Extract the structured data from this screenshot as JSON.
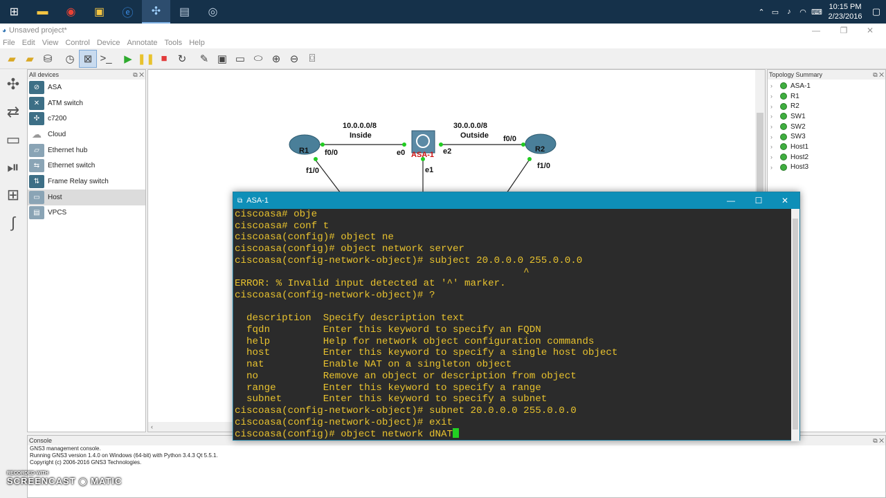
{
  "taskbar": {
    "icons": [
      "windows-icon",
      "file-explorer-icon",
      "chrome-icon",
      "app-icon",
      "edge-icon",
      "gns3-icon",
      "notepad-icon",
      "media-icon"
    ],
    "clock_time": "10:15 PM",
    "clock_date": "2/23/2016"
  },
  "window": {
    "title": "Unsaved project*"
  },
  "menu": [
    "File",
    "Edit",
    "View",
    "Control",
    "Device",
    "Annotate",
    "Tools",
    "Help"
  ],
  "devices_panel": {
    "title": "All devices",
    "items": [
      {
        "label": "ASA",
        "icon": "asa-icon"
      },
      {
        "label": "ATM switch",
        "icon": "atm-switch-icon"
      },
      {
        "label": "c7200",
        "icon": "router-icon"
      },
      {
        "label": "Cloud",
        "icon": "cloud-icon"
      },
      {
        "label": "Ethernet hub",
        "icon": "hub-icon"
      },
      {
        "label": "Ethernet switch",
        "icon": "switch-icon"
      },
      {
        "label": "Frame Relay switch",
        "icon": "frame-relay-icon"
      },
      {
        "label": "Host",
        "icon": "host-icon"
      },
      {
        "label": "VPCS",
        "icon": "vpcs-icon"
      }
    ]
  },
  "topology": {
    "nodes": {
      "r1": "R1",
      "r2": "R2",
      "asa": "ASA-1"
    },
    "ports": {
      "r1_f00": "f0/0",
      "asa_e0": "e0",
      "asa_e2": "e2",
      "r2_f00": "f0/0",
      "r1_f10": "f1/0",
      "asa_e1": "e1",
      "r2_f10": "f1/0"
    },
    "networks": {
      "inside_net": "10.0.0.0/8",
      "inside_name": "Inside",
      "outside_net": "30.0.0.0/8",
      "outside_name": "Outside"
    }
  },
  "topology_summary": {
    "title": "Topology Summary",
    "items": [
      "ASA-1",
      "R1",
      "R2",
      "SW1",
      "SW2",
      "SW3",
      "Host1",
      "Host2",
      "Host3"
    ]
  },
  "terminal": {
    "title": "ASA-1",
    "lines": [
      "ciscoasa# obje",
      "ciscoasa# conf t",
      "ciscoasa(config)# object ne",
      "ciscoasa(config)# object network server",
      "ciscoasa(config-network-object)# subject 20.0.0.0 255.0.0.0",
      "                                                 ^",
      "ERROR: % Invalid input detected at '^' marker.",
      "ciscoasa(config-network-object)# ?",
      "",
      "  description  Specify description text",
      "  fqdn         Enter this keyword to specify an FQDN",
      "  help         Help for network object configuration commands",
      "  host         Enter this keyword to specify a single host object",
      "  nat          Enable NAT on a singleton object",
      "  no           Remove an object or description from object",
      "  range        Enter this keyword to specify a range",
      "  subnet       Enter this keyword to specify a subnet",
      "ciscoasa(config-network-object)# subnet 20.0.0.0 255.0.0.0",
      "ciscoasa(config-network-object)# exit"
    ],
    "current_line": "ciscoasa(config)# object network dNAT"
  },
  "console": {
    "title": "Console",
    "lines": [
      "GNS3 management console.",
      "Running GNS3 version 1.4.0 on Windows (64-bit) with Python 3.4.3 Qt 5.5.1.",
      "Copyright (c) 2006-2016 GNS3 Technologies."
    ]
  },
  "watermark": {
    "small": "RECORDED WITH",
    "big": "SCREENCAST ◉ MATIC"
  }
}
